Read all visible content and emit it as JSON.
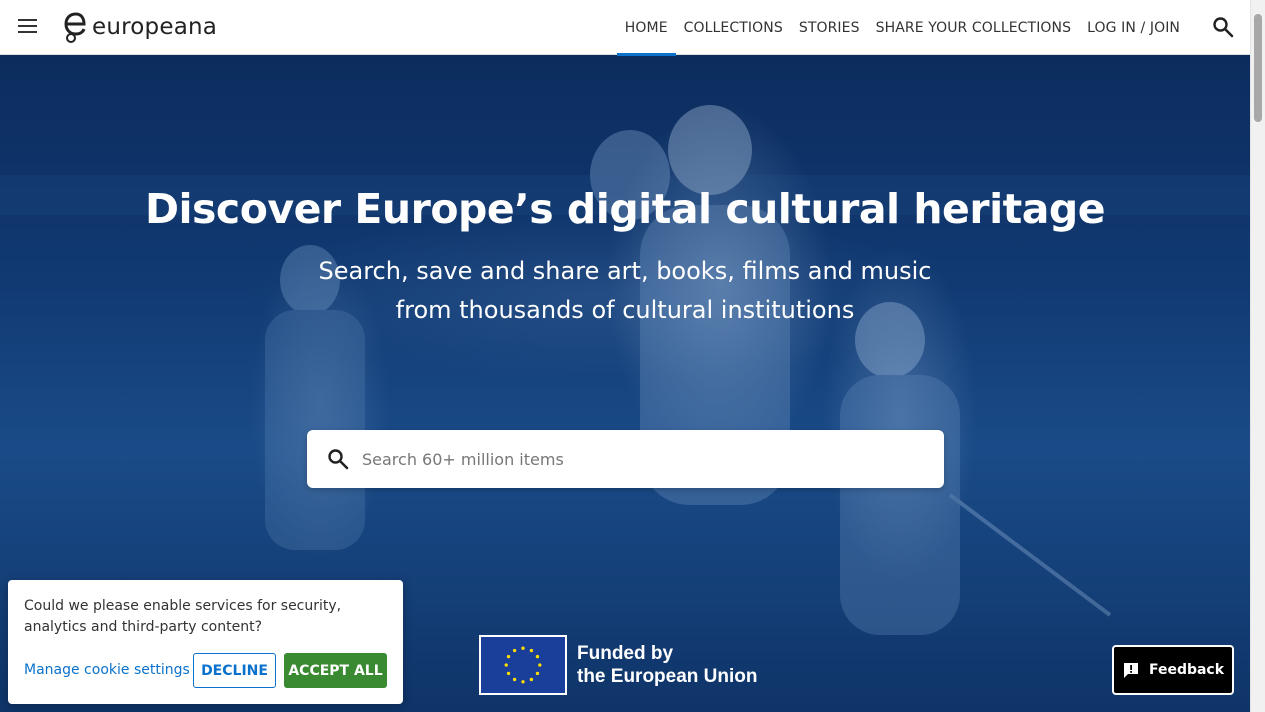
{
  "header": {
    "logo_text": "europeana",
    "nav": [
      {
        "label": "Home",
        "active": true
      },
      {
        "label": "Collections",
        "active": false
      },
      {
        "label": "Stories",
        "active": false
      },
      {
        "label": "Share your collections",
        "active": false
      },
      {
        "label": "Log in / Join",
        "active": false
      }
    ],
    "menu_icon": "hamburger-icon",
    "search_icon": "search-icon"
  },
  "hero": {
    "title": "Discover Europe’s digital cultural heritage",
    "subtitle_line1": "Search, save and share art, books, films and music",
    "subtitle_line2": "from thousands of cultural institutions",
    "search_placeholder": "Search 60+ million items"
  },
  "eu_funding": {
    "line1": "Funded by",
    "line2": "the European Union"
  },
  "cookie": {
    "message": "Could we please enable services for security, analytics and third-party content?",
    "manage_label": "Manage cookie settings",
    "decline_label": "DECLINE",
    "accept_label": "ACCEPT ALL"
  },
  "feedback": {
    "label": "Feedback",
    "icon": "feedback-icon"
  },
  "colors": {
    "accent": "#0a72cc",
    "accept_green": "#3a8a32",
    "hero_blue": "#113a73"
  }
}
